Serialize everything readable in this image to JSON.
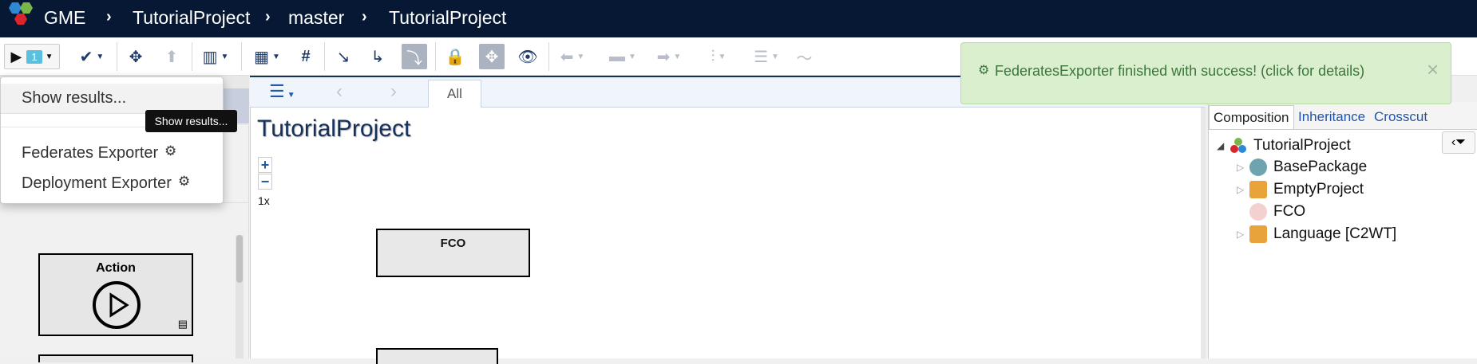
{
  "breadcrumb": {
    "app": "GME",
    "project": "TutorialProject",
    "branch": "master",
    "object": "TutorialProject"
  },
  "toolbar": {
    "run_count": "1",
    "run_icon": "play-icon",
    "colors": {
      "accent": "#16305c",
      "badge": "#5bc0de",
      "nav": "#071834"
    }
  },
  "menu": {
    "show_results": "Show results...",
    "items": [
      "Federates Exporter",
      "Deployment Exporter"
    ]
  },
  "tooltip": {
    "text": "Show results..."
  },
  "notification": {
    "message": "FederatesExporter finished with success! (click for details)",
    "close": "×",
    "color": "#3c763d"
  },
  "center": {
    "tab_all": "All",
    "title": "TutorialProject",
    "zoom_in": "+",
    "zoom_out": "−",
    "zoom_level": "1x",
    "boxes": [
      "FCO"
    ]
  },
  "parts": [
    "Action"
  ],
  "right": {
    "tabs": [
      "Composition",
      "Inheritance",
      "Crosscut"
    ],
    "tree": [
      {
        "label": "TutorialProject"
      },
      {
        "label": "BasePackage"
      },
      {
        "label": "EmptyProject"
      },
      {
        "label": "FCO"
      },
      {
        "label": "Language [C2WT]"
      }
    ]
  }
}
